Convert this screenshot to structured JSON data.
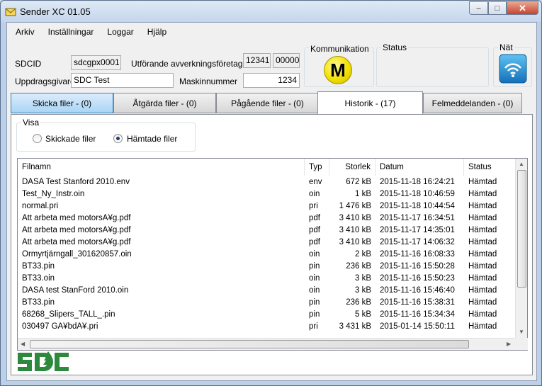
{
  "window": {
    "title": "Sender XC 01.05"
  },
  "menu": [
    "Arkiv",
    "Inställningar",
    "Loggar",
    "Hjälp"
  ],
  "form": {
    "sdcid_label": "SDCID",
    "sdcid_value": "sdcgpx0001",
    "company_label": "Utförande avverkningsföretag",
    "company_code1": "12341",
    "company_code2": "00000",
    "client_label": "Uppdragsgivare",
    "client_value": "SDC Test",
    "machine_label": "Maskinnummer",
    "machine_value": "1234"
  },
  "groups": {
    "communication": "Kommunikation",
    "communication_letter": "M",
    "status": "Status",
    "network": "Nät"
  },
  "tabs": [
    "Skicka filer - (0)",
    "Åtgärda filer - (0)",
    "Pågående filer - (0)",
    "Historik - (17)",
    "Felmeddelanden - (0)"
  ],
  "view": {
    "title": "Visa",
    "options": [
      "Skickade filer",
      "Hämtade filer"
    ],
    "selected": "Hämtade filer"
  },
  "table": {
    "headers": [
      "Filnamn",
      "Typ",
      "Storlek",
      "Datum",
      "Status"
    ],
    "rows": [
      [
        "DASA Test Stanford 2010.env",
        "env",
        "672 kB",
        "2015-11-18 16:24:21",
        "Hämtad"
      ],
      [
        "Test_Ny_Instr.oin",
        "oin",
        "1 kB",
        "2015-11-18 10:46:59",
        "Hämtad"
      ],
      [
        "normal.pri",
        "pri",
        "1 476 kB",
        "2015-11-18 10:44:54",
        "Hämtad"
      ],
      [
        "Att arbeta med motorsÃ¥g.pdf",
        "pdf",
        "3 410 kB",
        "2015-11-17 16:34:51",
        "Hämtad"
      ],
      [
        "Att arbeta med motorsÃ¥g.pdf",
        "pdf",
        "3 410 kB",
        "2015-11-17 14:35:01",
        "Hämtad"
      ],
      [
        "Att arbeta med motorsÃ¥g.pdf",
        "pdf",
        "3 410 kB",
        "2015-11-17 14:06:32",
        "Hämtad"
      ],
      [
        "Ormyrtjärngall_301620857.oin",
        "oin",
        "2 kB",
        "2015-11-16 16:08:33",
        "Hämtad"
      ],
      [
        "BT33.pin",
        "pin",
        "236 kB",
        "2015-11-16 15:50:28",
        "Hämtad"
      ],
      [
        "BT33.oin",
        "oin",
        "3 kB",
        "2015-11-16 15:50:23",
        "Hämtad"
      ],
      [
        "DASA test StanFord 2010.oin",
        "oin",
        "3 kB",
        "2015-11-16 15:46:40",
        "Hämtad"
      ],
      [
        "BT33.pin",
        "pin",
        "236 kB",
        "2015-11-16 15:38:31",
        "Hämtad"
      ],
      [
        "68268_Slipers_TALL_.pin",
        "pin",
        "5 kB",
        "2015-11-16 15:34:34",
        "Hämtad"
      ],
      [
        "030497 GÃ¥bdÃ¥.pri",
        "pri",
        "3 431 kB",
        "2015-01-14 15:50:11",
        "Hämtad"
      ]
    ]
  },
  "logo": {
    "text": "SDC"
  },
  "colors": {
    "tab_blue": "#a9d5f5",
    "logo_green": "#2d8a3d",
    "comm_yellow": "#f5e400",
    "net_blue": "#1e90d6"
  }
}
